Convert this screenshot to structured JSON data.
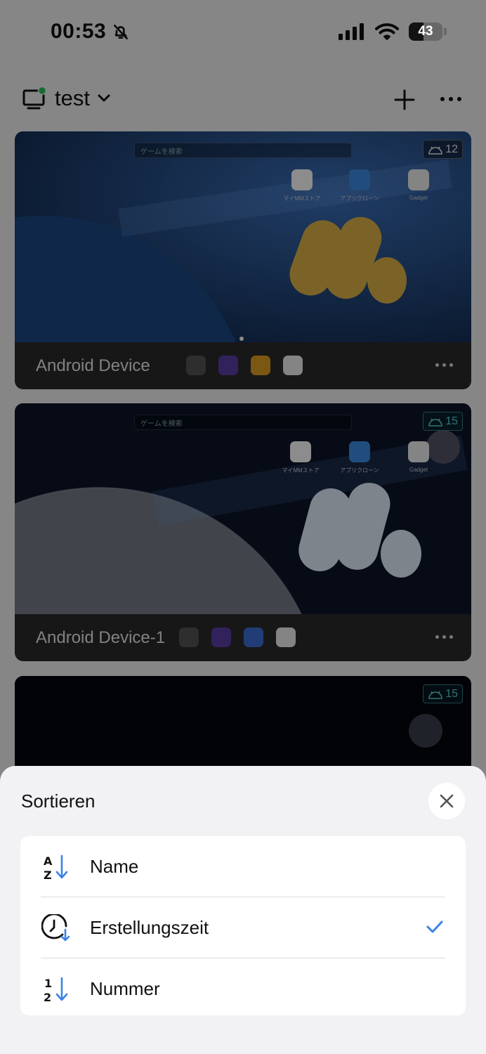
{
  "status_bar": {
    "time": "00:53",
    "battery": "43",
    "battery_level": 0.43
  },
  "top_bar": {
    "workspace_name": "test"
  },
  "devices": [
    {
      "name": "Android Device",
      "android_version": "12",
      "search_placeholder": "ゲームを検索",
      "apps": [
        "マイMMストア",
        "アプリクローン",
        "Gadget"
      ]
    },
    {
      "name": "Android Device-1",
      "android_version": "15",
      "search_placeholder": "ゲームを検索",
      "apps": [
        "マイMMストア",
        "アプリクローン",
        "Gadget"
      ]
    },
    {
      "android_version": "15"
    }
  ],
  "sort_sheet": {
    "title": "Sortieren",
    "options": [
      {
        "label": "Name",
        "icon": "sort-alpha-icon",
        "selected": false
      },
      {
        "label": "Erstellungszeit",
        "icon": "clock-sort-icon",
        "selected": true
      },
      {
        "label": "Nummer",
        "icon": "sort-numeric-icon",
        "selected": false
      }
    ]
  },
  "colors": {
    "accent": "#3b82e6",
    "status_online": "#2ec45a"
  }
}
